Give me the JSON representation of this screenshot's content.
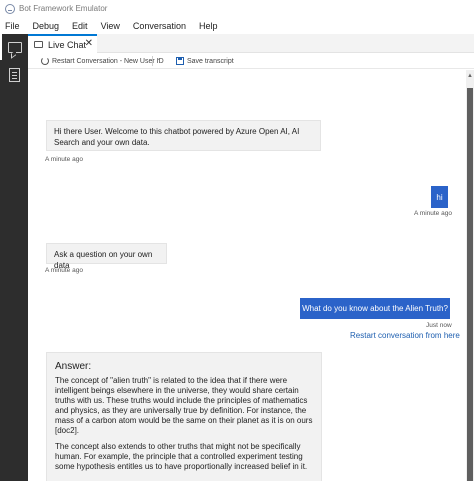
{
  "window": {
    "title": "Bot Framework Emulator"
  },
  "menu": [
    "File",
    "Debug",
    "Edit",
    "View",
    "Conversation",
    "Help"
  ],
  "activity_bar": {
    "items": [
      "chat-icon",
      "document-icon"
    ]
  },
  "tabs": [
    {
      "label": "Live Chat",
      "close": "✕"
    }
  ],
  "toolbar": {
    "restart_label": "Restart Conversation - New User ID",
    "chevron": "⌄",
    "save_label": "Save transcript"
  },
  "messages": [
    {
      "from": "bot",
      "text": "Hi there User. Welcome to this chatbot powered by Azure Open AI, AI Search and your own data.",
      "timestamp": "A minute ago"
    },
    {
      "from": "user",
      "text": "hi",
      "timestamp": "A minute ago"
    },
    {
      "from": "bot",
      "text": "Ask a question on your own data",
      "timestamp": "A minute ago"
    },
    {
      "from": "user",
      "text": "What do you know about the Alien Truth?",
      "timestamp": "Just now"
    },
    {
      "from": "bot",
      "title": "Answer:",
      "paragraphs": [
        "The concept of \"alien truth\" is related to the idea that if there were intelligent beings elsewhere in the universe, they would share certain truths with us. These truths would include the principles of mathematics and physics, as they are universally true by definition. For instance, the mass of a carbon atom would be the same on their planet as it is on ours [doc2].",
        "The concept also extends to other truths that might not be specifically human. For example, the principle that a controlled experiment testing some hypothesis entitles us to have proportionally increased belief in it."
      ]
    }
  ],
  "suggested_action": "Restart conversation from here",
  "colors": {
    "accent": "#2b63c9",
    "link": "#1e5fb0",
    "activity_bar": "#2d2d2d",
    "bot_bubble": "#f2f2f2"
  }
}
